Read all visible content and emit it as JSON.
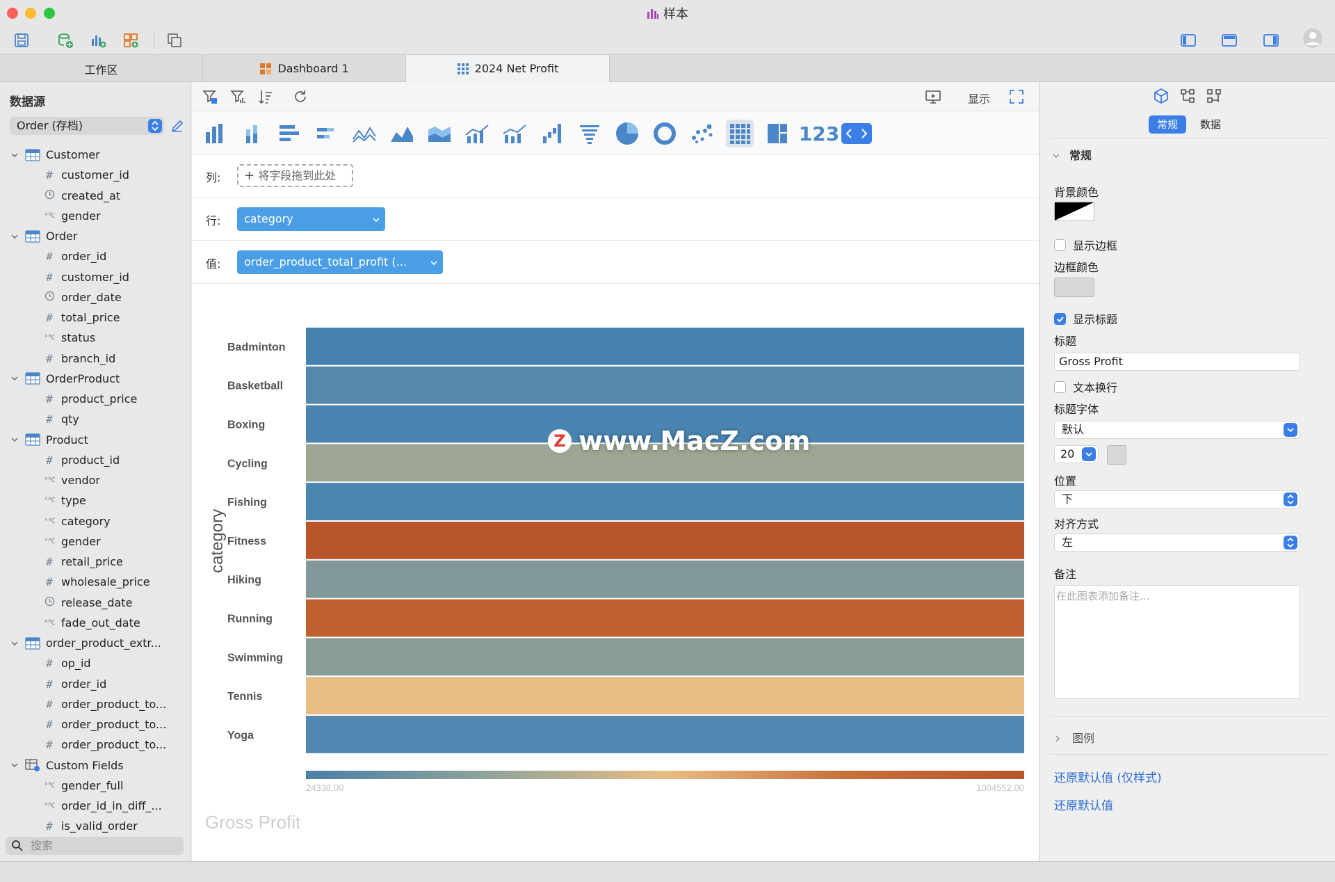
{
  "window": {
    "title": "样本"
  },
  "tabs": [
    {
      "label": "工作区"
    },
    {
      "label": "Dashboard 1"
    },
    {
      "label": "2024 Net Profit"
    }
  ],
  "sidebar": {
    "heading": "数据源",
    "source": "Order (存档)",
    "search_placeholder": "搜索",
    "tree": [
      {
        "kind": "table",
        "label": "Customer"
      },
      {
        "kind": "field",
        "type": "num",
        "label": "customer_id"
      },
      {
        "kind": "field",
        "type": "time",
        "label": "created_at"
      },
      {
        "kind": "field",
        "type": "abc",
        "label": "gender"
      },
      {
        "kind": "table",
        "label": "Order"
      },
      {
        "kind": "field",
        "type": "num",
        "label": "order_id"
      },
      {
        "kind": "field",
        "type": "num",
        "label": "customer_id"
      },
      {
        "kind": "field",
        "type": "time",
        "label": "order_date"
      },
      {
        "kind": "field",
        "type": "num",
        "label": "total_price"
      },
      {
        "kind": "field",
        "type": "abc",
        "label": "status"
      },
      {
        "kind": "field",
        "type": "num",
        "label": "branch_id"
      },
      {
        "kind": "table",
        "label": "OrderProduct"
      },
      {
        "kind": "field",
        "type": "num",
        "label": "product_price"
      },
      {
        "kind": "field",
        "type": "num",
        "label": "qty"
      },
      {
        "kind": "table",
        "label": "Product"
      },
      {
        "kind": "field",
        "type": "num",
        "label": "product_id"
      },
      {
        "kind": "field",
        "type": "abc",
        "label": "vendor"
      },
      {
        "kind": "field",
        "type": "abc",
        "label": "type"
      },
      {
        "kind": "field",
        "type": "abc",
        "label": "category"
      },
      {
        "kind": "field",
        "type": "abc",
        "label": "gender"
      },
      {
        "kind": "field",
        "type": "num",
        "label": "retail_price"
      },
      {
        "kind": "field",
        "type": "num",
        "label": "wholesale_price"
      },
      {
        "kind": "field",
        "type": "time",
        "label": "release_date"
      },
      {
        "kind": "field",
        "type": "abc",
        "label": "fade_out_date"
      },
      {
        "kind": "table",
        "label": "order_product_extr..."
      },
      {
        "kind": "field",
        "type": "num",
        "label": "op_id"
      },
      {
        "kind": "field",
        "type": "num",
        "label": "order_id"
      },
      {
        "kind": "field",
        "type": "num",
        "label": "order_product_to..."
      },
      {
        "kind": "field",
        "type": "num",
        "label": "order_product_to..."
      },
      {
        "kind": "field",
        "type": "num",
        "label": "order_product_to..."
      },
      {
        "kind": "table",
        "label": "Custom Fields",
        "custom": true
      },
      {
        "kind": "field",
        "type": "abc",
        "label": "gender_full"
      },
      {
        "kind": "field",
        "type": "abc",
        "label": "order_id_in_diff_..."
      },
      {
        "kind": "field",
        "type": "num",
        "label": "is_valid_order"
      }
    ]
  },
  "center": {
    "display_label": "显示",
    "shelves": {
      "columns_label": "列:",
      "columns_drop": "将字段拖到此处",
      "rows_label": "行:",
      "rows_value": "category",
      "values_label": "值:",
      "values_value": "order_product_total_profit (..."
    },
    "number_chart_label": "123"
  },
  "chart_data": {
    "type": "heatmap",
    "title": "Gross Profit",
    "title_position": "bottom",
    "ylabel": "category",
    "categories": [
      "Badminton",
      "Basketball",
      "Boxing",
      "Cycling",
      "Fishing",
      "Fitness",
      "Hiking",
      "Running",
      "Swimming",
      "Tennis",
      "Yoga"
    ],
    "colors": [
      "#4682b0",
      "#5488ad",
      "#4a85b2",
      "#9da692",
      "#4b86b0",
      "#b8552b",
      "#82989a",
      "#c0612f",
      "#8a9c98",
      "#e8bd84",
      "#5187b0"
    ],
    "legend": {
      "min": "24338.00",
      "max": "1004552.00",
      "colors": [
        "#4a7fa8",
        "#8ea39a",
        "#e8bd84",
        "#c8703a",
        "#b8552b"
      ]
    }
  },
  "settings": {
    "tabs": [
      "常规",
      "数据"
    ],
    "section": "常规",
    "bg_color_label": "背景颜色",
    "show_border_label": "显示边框",
    "border_color_label": "边框颜色",
    "show_title_label": "显示标题",
    "title_label": "标题",
    "title_value": "Gross Profit",
    "wrap_label": "文本换行",
    "title_font_label": "标题字体",
    "title_font_value": "默认",
    "font_size": "20",
    "position_label": "位置",
    "position_value": "下",
    "align_label": "对齐方式",
    "align_value": "左",
    "notes_label": "备注",
    "notes_placeholder": "在此图表添加备注...",
    "legend_section": "图例",
    "reset_style": "还原默认值 (仅样式)",
    "reset_all": "还原默认值"
  },
  "watermark": "www.MacZ.com"
}
